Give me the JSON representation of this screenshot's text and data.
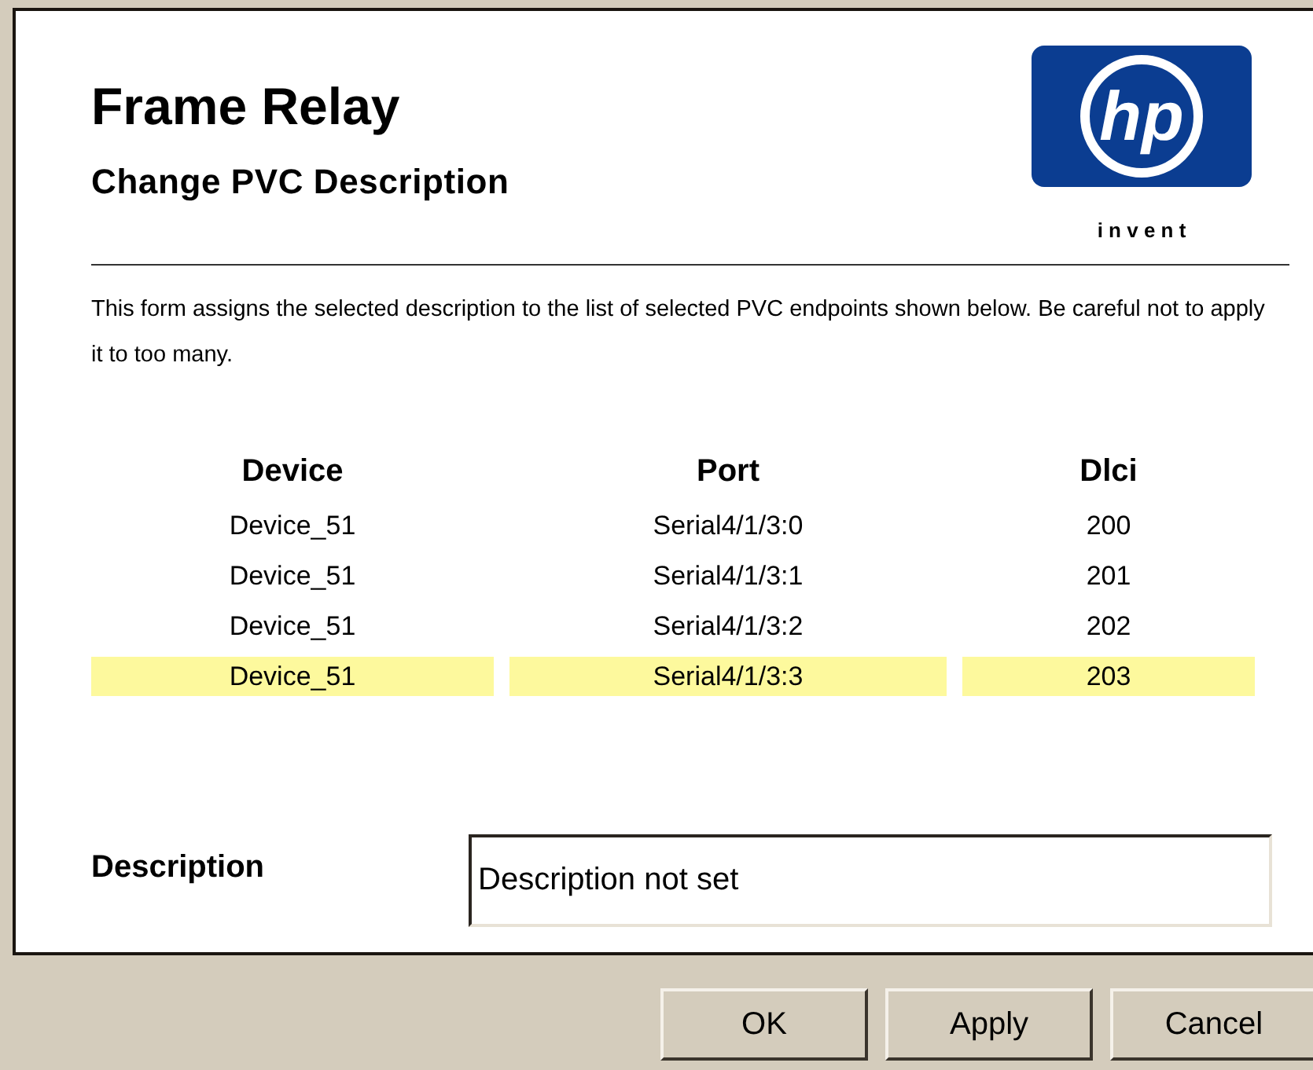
{
  "title": "Frame Relay",
  "subtitle": "Change PVC Description",
  "logo": {
    "mark": "hp",
    "tagline": "i n v e n t"
  },
  "intro": "This form assigns the selected description to the list of selected PVC endpoints shown below. Be careful not to apply it to too many.",
  "table": {
    "columns": [
      "Device",
      "Port",
      "Dlci"
    ],
    "rows": [
      {
        "cells": [
          "Device_51",
          "Serial4/1/3:0",
          "200"
        ],
        "selected": false
      },
      {
        "cells": [
          "Device_51",
          "Serial4/1/3:1",
          "201"
        ],
        "selected": false
      },
      {
        "cells": [
          "Device_51",
          "Serial4/1/3:2",
          "202"
        ],
        "selected": false
      },
      {
        "cells": [
          "Device_51",
          "Serial4/1/3:3",
          "203"
        ],
        "selected": true
      }
    ]
  },
  "description": {
    "label": "Description",
    "value": "Description not set"
  },
  "buttons": [
    "OK",
    "Apply",
    "Cancel"
  ]
}
